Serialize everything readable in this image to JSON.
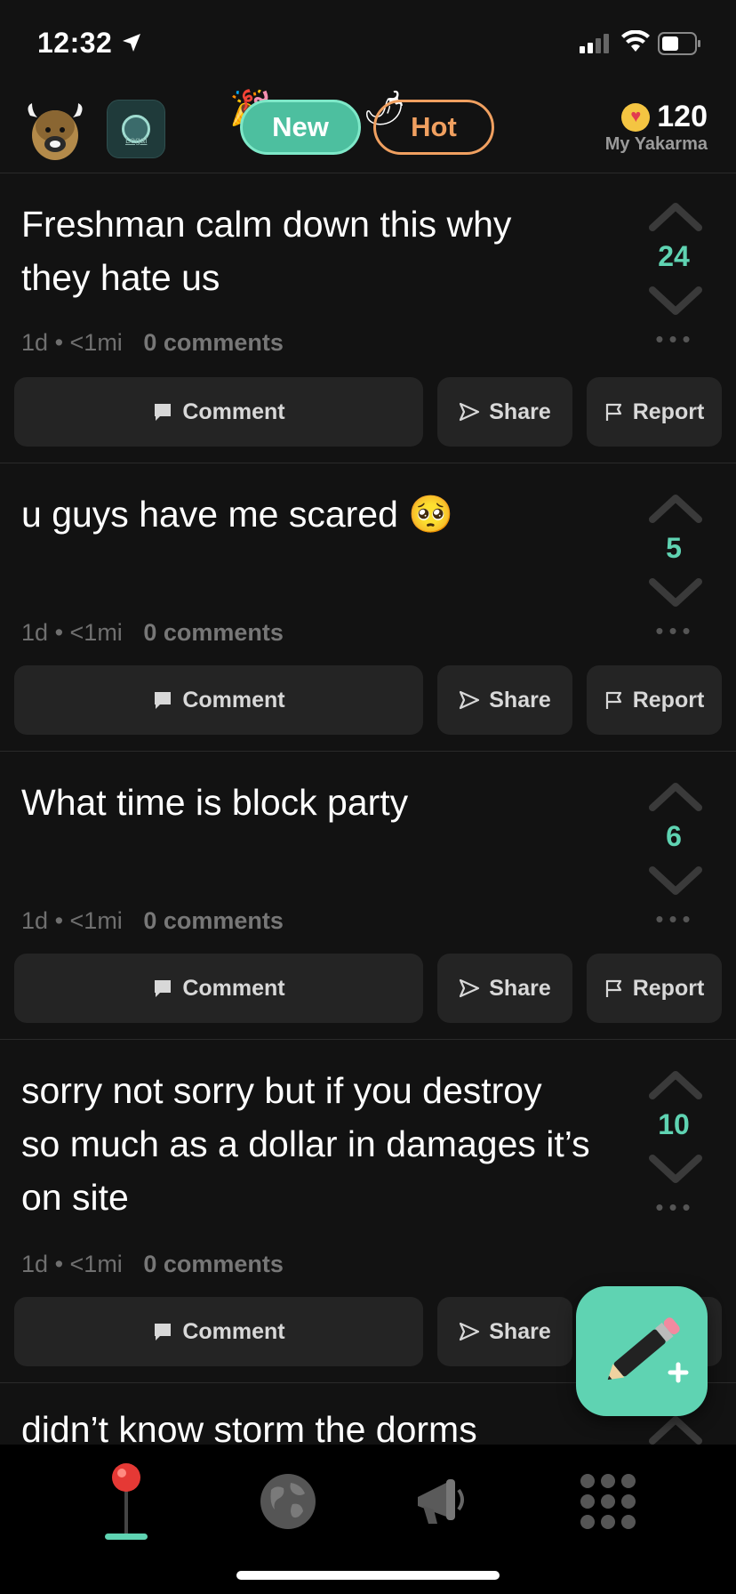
{
  "status_bar": {
    "time": "12:32"
  },
  "header": {
    "tabs": [
      {
        "label": "New",
        "active": true
      },
      {
        "label": "Hot",
        "active": false
      }
    ],
    "karma": {
      "value": "120",
      "label": "My Yakarma"
    },
    "school_badge_text": "Legal"
  },
  "posts": [
    {
      "text": "Freshman calm down this why they hate us",
      "votes": "24",
      "age": "1d",
      "distance": "<1mi",
      "comments": "0 comments"
    },
    {
      "text": "u guys have me scared 🥺",
      "votes": "5",
      "age": "1d",
      "distance": "<1mi",
      "comments": "0 comments"
    },
    {
      "text": "What time is block party",
      "votes": "6",
      "age": "1d",
      "distance": "<1mi",
      "comments": "0 comments"
    },
    {
      "text": "sorry not sorry but if you destroy so much as a dollar in damages it’s on site",
      "votes": "10",
      "age": "1d",
      "distance": "<1mi",
      "comments": "0 comments"
    }
  ],
  "peek_post": {
    "text": "didn’t know storm the dorms"
  },
  "actions": {
    "comment": "Comment",
    "share": "Share",
    "report": "Report"
  },
  "meta_separator": "•",
  "nav": [
    "local-pin",
    "globe",
    "megaphone",
    "grid-menu"
  ],
  "colors": {
    "accent": "#5fd3b2",
    "hot": "#f0a060",
    "background": "#121212"
  }
}
